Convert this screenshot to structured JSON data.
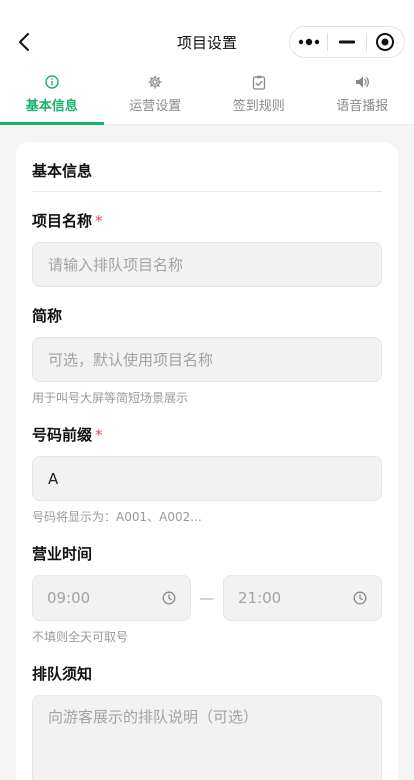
{
  "navbar": {
    "title": "项目设置",
    "back_icon": "chevron-left-icon",
    "capsule": {
      "more_icon": "more-dots-icon",
      "minimize_icon": "minimize-icon",
      "close_icon": "target-close-icon"
    }
  },
  "tabs": [
    {
      "label": "基本信息",
      "icon": "info-icon",
      "active": true
    },
    {
      "label": "运营设置",
      "icon": "gear-icon",
      "active": false
    },
    {
      "label": "签到规则",
      "icon": "clipboard-check-icon",
      "active": false
    },
    {
      "label": "语音播报",
      "icon": "speaker-icon",
      "active": false
    }
  ],
  "card": {
    "section_title": "基本信息",
    "project_name": {
      "label": "项目名称",
      "required": "*",
      "placeholder": "请输入排队项目名称"
    },
    "short_name": {
      "label": "简称",
      "placeholder": "可选，默认使用项目名称",
      "hint": "用于叫号大屏等简短场景展示"
    },
    "number_prefix": {
      "label": "号码前缀",
      "required": "*",
      "value": "A",
      "hint": "号码将显示为：A001、A002..."
    },
    "business_hours": {
      "label": "营业时间",
      "start": "09:00",
      "separator": "—",
      "end": "21:00",
      "hint": "不填则全天可取号"
    },
    "queue_notice": {
      "label": "排队须知",
      "placeholder": "向游客展示的排队说明（可选）"
    }
  },
  "colors": {
    "accent": "#18b26b",
    "required": "#e54848"
  }
}
